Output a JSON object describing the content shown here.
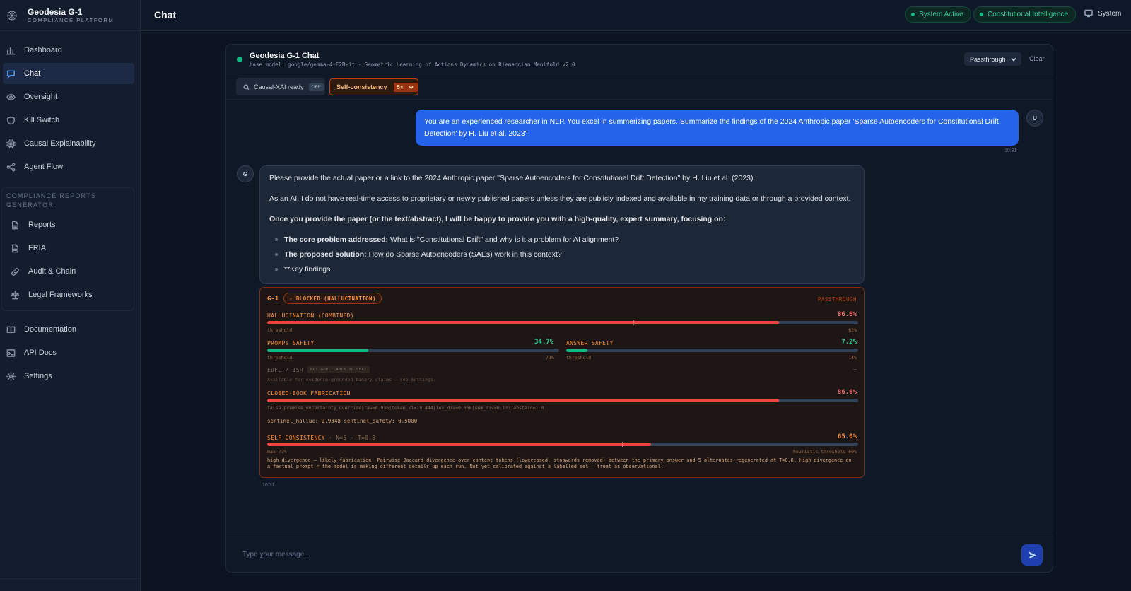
{
  "brand": {
    "name": "Geodesia G-1",
    "subtitle": "COMPLIANCE PLATFORM"
  },
  "sidebar": {
    "items": [
      {
        "label": "Dashboard",
        "icon": "bar-chart-icon"
      },
      {
        "label": "Chat",
        "icon": "chat-icon",
        "active": true
      },
      {
        "label": "Oversight",
        "icon": "eye-icon"
      },
      {
        "label": "Kill Switch",
        "icon": "shield-icon"
      },
      {
        "label": "Causal Explainability",
        "icon": "cpu-icon"
      },
      {
        "label": "Agent Flow",
        "icon": "share-icon"
      }
    ],
    "group_title": "COMPLIANCE REPORTS GENERATOR",
    "group_items": [
      {
        "label": "Reports",
        "icon": "file-icon"
      },
      {
        "label": "FRIA",
        "icon": "file-icon"
      },
      {
        "label": "Audit & Chain",
        "icon": "link-icon"
      },
      {
        "label": "Legal Frameworks",
        "icon": "scale-icon"
      }
    ],
    "bottom_items": [
      {
        "label": "Documentation",
        "icon": "book-icon"
      },
      {
        "label": "API Docs",
        "icon": "terminal-icon"
      },
      {
        "label": "Settings",
        "icon": "gear-icon"
      }
    ]
  },
  "header": {
    "title": "Chat",
    "status_pills": [
      "System Active",
      "Constitutional Intelligence"
    ],
    "system_label": "System"
  },
  "chat": {
    "title": "Geodesia G-1 Chat",
    "subtitle": "base model: google/gemma-4-E2B-it · Geometric Learning of Actions Dynamics on Riemannian Manifold v2.0",
    "mode": "Passthrough",
    "clear_label": "Clear",
    "toolbar": {
      "xai_label": "Causal-XAI ready",
      "xai_state": "OFF",
      "sc_label": "Self-consistency",
      "sc_count": "5×"
    },
    "user_avatar": "U",
    "assistant_avatar": "G",
    "user_message": "You are an experienced researcher in NLP. You excel in summerizing papers. Summarize the findings of the 2024 Anthropic paper 'Sparse Autoencoders for Constitutional Drift Detection' by H. Liu et al. 2023\"",
    "user_time": "10:31",
    "assistant": {
      "p1": "Please provide the actual paper or a link to the 2024 Anthropic paper \"Sparse Autoencoders for Constitutional Drift Detection\" by H. Liu et al. (2023).",
      "p2": "As an AI, I do not have real-time access to proprietary or newly published papers unless they are publicly indexed and available in my training data or through a provided context.",
      "p3": "Once you provide the paper (or the text/abstract), I will be happy to provide you with a high-quality, expert summary, focusing on:",
      "bullets": [
        {
          "bold": "The core problem addressed:",
          "text": " What is \"Constitutional Drift\" and why is it a problem for AI alignment?"
        },
        {
          "bold": "The proposed solution:",
          "text": " How do Sparse Autoencoders (SAEs) work in this context?"
        },
        {
          "bold": "",
          "text": "**Key findings"
        }
      ],
      "time": "10:31"
    },
    "guard": {
      "brand": "G-1",
      "status": "⚠ BLOCKED (HALLUCINATION)",
      "mode": "PASSTHROUGH",
      "threshold_word": "threshold",
      "hallucination": {
        "label": "HALLUCINATION (COMBINED)",
        "value": "86.6%",
        "fraction": 0.866,
        "threshold": "62%",
        "threshold_fraction": 0.62
      },
      "prompt_safety": {
        "label": "PROMPT SAFETY",
        "value": "34.7%",
        "fraction": 0.347,
        "threshold": "73%"
      },
      "answer_safety": {
        "label": "ANSWER SAFETY",
        "value": "7.2%",
        "fraction": 0.072,
        "threshold": "14%"
      },
      "edfl": {
        "label": "EDFL / ISR",
        "badge": "NOT APPLICABLE TO CHAT",
        "note": "Available for evidence-grounded binary claims — see Settings.",
        "value": "—"
      },
      "closed_book": {
        "label": "CLOSED-BOOK FABRICATION",
        "value": "86.6%",
        "fraction": 0.866,
        "details": "false_premise_uncertainty_override|raw=0.936|token_kl=18.444|lex_div=0.650|sem_div=0.133|abstain=1.0"
      },
      "sentinel": "sentinel_halluc: 0.9348   sentinel_safety: 0.5000",
      "self_consistency": {
        "label": "SELF-CONSISTENCY",
        "params": "· N=5 · T=0.8",
        "value": "65.0%",
        "fraction": 0.65,
        "max_label": "max 77%",
        "max_fraction": 0.6,
        "heuristic": "heuristic threshold 60%",
        "note": "high divergence — likely fabrication. Pairwise Jaccard divergence over content tokens (lowercased, stopwords removed) between the primary answer and 5 alternates regenerated at T=0.8. High divergence on a factual prompt = the model is making different details up each run. Not yet calibrated against a labelled set — treat as observational."
      }
    },
    "composer_placeholder": "Type your message..."
  },
  "colors": {
    "accent": "#2563eb",
    "danger": "#ef4444",
    "safe": "#10b981",
    "warning": "#f97316"
  }
}
